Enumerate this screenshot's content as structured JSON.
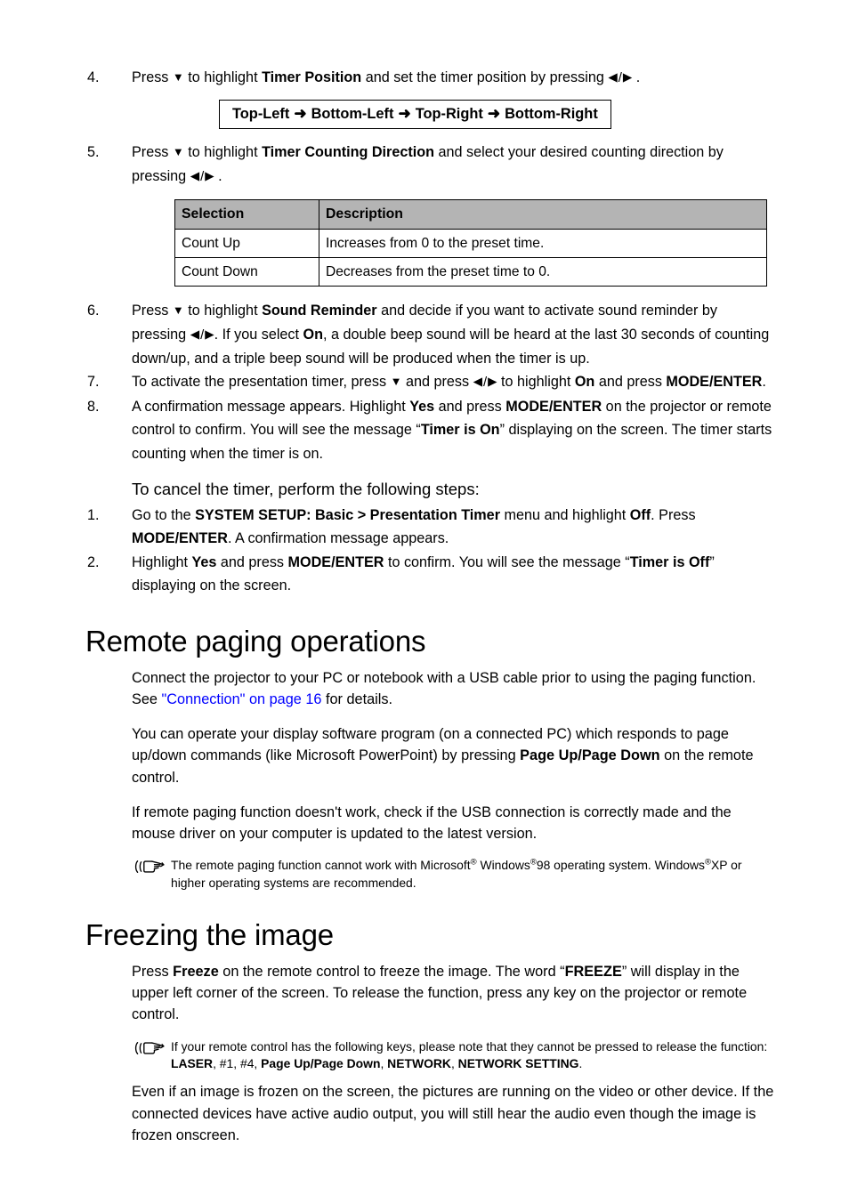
{
  "steps_timer": [
    {
      "num": "4.",
      "segments": [
        {
          "t": "Press ",
          "s": "n"
        },
        {
          "t": "▼",
          "s": "tri"
        },
        {
          "t": " to highlight ",
          "s": "n"
        },
        {
          "t": "Timer Position",
          "s": "b"
        },
        {
          "t": " and set the timer position by pressing ",
          "s": "n"
        },
        {
          "t": "◀/▶",
          "s": "lr"
        },
        {
          "t": " .",
          "s": "n"
        }
      ]
    },
    {
      "num": "5.",
      "segments": [
        {
          "t": "Press ",
          "s": "n"
        },
        {
          "t": "▼",
          "s": "tri"
        },
        {
          "t": " to highlight ",
          "s": "n"
        },
        {
          "t": "Timer Counting Direction",
          "s": "b"
        },
        {
          "t": " and select your desired counting direction by pressing ",
          "s": "n"
        },
        {
          "t": "◀/▶",
          "s": "lr"
        },
        {
          "t": " .",
          "s": "n"
        }
      ]
    },
    {
      "num": "6.",
      "segments": [
        {
          "t": "Press ",
          "s": "n"
        },
        {
          "t": "▼",
          "s": "tri"
        },
        {
          "t": " to highlight ",
          "s": "n"
        },
        {
          "t": "Sound Reminder",
          "s": "b"
        },
        {
          "t": " and decide if you want to activate sound reminder by pressing ",
          "s": "n"
        },
        {
          "t": "◀/▶",
          "s": "lr"
        },
        {
          "t": ". If you select ",
          "s": "n"
        },
        {
          "t": "On",
          "s": "b"
        },
        {
          "t": ", a double beep sound will be heard at the last 30 seconds of counting down/up, and a triple beep sound will be produced when the timer is up.",
          "s": "n"
        }
      ]
    },
    {
      "num": "7.",
      "segments": [
        {
          "t": "To activate the presentation timer, press ",
          "s": "n"
        },
        {
          "t": "▼",
          "s": "tri"
        },
        {
          "t": " and press ",
          "s": "n"
        },
        {
          "t": "◀/▶",
          "s": "lr"
        },
        {
          "t": " to highlight ",
          "s": "n"
        },
        {
          "t": "On",
          "s": "b"
        },
        {
          "t": " and press ",
          "s": "n"
        },
        {
          "t": "MODE/ENTER",
          "s": "b"
        },
        {
          "t": ".",
          "s": "n"
        }
      ]
    },
    {
      "num": "8.",
      "segments": [
        {
          "t": "A confirmation message appears. Highlight ",
          "s": "n"
        },
        {
          "t": "Yes",
          "s": "b"
        },
        {
          "t": " and press ",
          "s": "n"
        },
        {
          "t": "MODE/ENTER",
          "s": "b"
        },
        {
          "t": " on the projector or remote control to confirm. You will see the message “",
          "s": "n"
        },
        {
          "t": "Timer is On",
          "s": "b"
        },
        {
          "t": "” displaying on the screen. The timer starts counting when the timer is on.",
          "s": "n"
        }
      ]
    }
  ],
  "position_box": {
    "items": [
      "Top-Left",
      "Bottom-Left",
      "Top-Right",
      "Bottom-Right"
    ],
    "arrow": "➜"
  },
  "selection_table": {
    "headers": [
      "Selection",
      "Description"
    ],
    "rows": [
      [
        "Count Up",
        "Increases from 0 to the preset time."
      ],
      [
        "Count Down",
        "Decreases from the preset time to 0."
      ]
    ]
  },
  "cancel_section": {
    "heading": "To cancel the timer, perform the following steps:",
    "steps": [
      {
        "num": "1.",
        "segments": [
          {
            "t": "Go to the ",
            "s": "n"
          },
          {
            "t": "SYSTEM SETUP: Basic > Presentation Timer",
            "s": "b"
          },
          {
            "t": " menu and highlight ",
            "s": "n"
          },
          {
            "t": "Off",
            "s": "b"
          },
          {
            "t": ". Press ",
            "s": "n"
          },
          {
            "t": "MODE/ENTER",
            "s": "b"
          },
          {
            "t": ". A confirmation message appears.",
            "s": "n"
          }
        ]
      },
      {
        "num": "2.",
        "segments": [
          {
            "t": "Highlight ",
            "s": "n"
          },
          {
            "t": "Yes",
            "s": "b"
          },
          {
            "t": " and press ",
            "s": "n"
          },
          {
            "t": "MODE/ENTER",
            "s": "b"
          },
          {
            "t": " to confirm. You will see the message “",
            "s": "n"
          },
          {
            "t": "Timer is Off",
            "s": "b"
          },
          {
            "t": "” displaying on the screen.",
            "s": "n"
          }
        ]
      }
    ]
  },
  "remote_paging": {
    "heading": "Remote paging operations",
    "paragraphs": [
      [
        {
          "t": "Connect the projector to your PC or notebook with a USB cable prior to using the paging function. See ",
          "s": "n"
        },
        {
          "t": "\"Connection\" on page 16",
          "s": "link"
        },
        {
          "t": " for details.",
          "s": "n"
        }
      ],
      [
        {
          "t": "You can operate your display software program (on a connected PC) which responds to page up/down commands (like Microsoft PowerPoint) by pressing ",
          "s": "n"
        },
        {
          "t": "Page Up/Page Down",
          "s": "b"
        },
        {
          "t": " on the remote control.",
          "s": "n"
        }
      ],
      [
        {
          "t": "If remote paging function doesn't work, check if the USB connection is correctly made and the mouse driver on your computer is updated to the latest version.",
          "s": "n"
        }
      ]
    ],
    "note": [
      {
        "t": "The remote paging function cannot work with Microsoft",
        "s": "n"
      },
      {
        "t": "®",
        "s": "reg"
      },
      {
        "t": " Windows",
        "s": "n"
      },
      {
        "t": "®",
        "s": "reg"
      },
      {
        "t": "98 operating system. Windows",
        "s": "n"
      },
      {
        "t": "®",
        "s": "reg"
      },
      {
        "t": "XP or higher operating systems are recommended.",
        "s": "n"
      }
    ]
  },
  "freezing": {
    "heading": "Freezing the image",
    "paragraphs": [
      [
        {
          "t": "Press ",
          "s": "n"
        },
        {
          "t": "Freeze",
          "s": "b"
        },
        {
          "t": " on the remote control to freeze the image. The word “",
          "s": "n"
        },
        {
          "t": "FREEZE",
          "s": "b"
        },
        {
          "t": "” will display in the upper left corner of the screen. To release the function, press any key on the projector or remote control.",
          "s": "n"
        }
      ]
    ],
    "note": [
      {
        "t": "If your remote control has the following keys, please note that they cannot be pressed to release the function: ",
        "s": "n"
      },
      {
        "t": "LASER",
        "s": "b"
      },
      {
        "t": ", #1, #4, ",
        "s": "n"
      },
      {
        "t": "Page Up/Page Down",
        "s": "b"
      },
      {
        "t": ", ",
        "s": "n"
      },
      {
        "t": "NETWORK",
        "s": "b"
      },
      {
        "t": ", ",
        "s": "n"
      },
      {
        "t": "NETWORK SETTING",
        "s": "b"
      },
      {
        "t": ".",
        "s": "n"
      }
    ],
    "closing_paragraph": [
      {
        "t": "Even if an image is frozen on the screen, the pictures are running on the video or other device. If the connected devices have active audio output, you will still hear the audio even though the image is frozen onscreen.",
        "s": "n"
      }
    ]
  },
  "colors": {
    "link": "#0000ff",
    "table_header_bg": "#b4b4b4",
    "text": "#000000"
  },
  "icons": {
    "note": "pointing-hand-icon",
    "down_triangle": "▼",
    "left_triangle": "◀",
    "right_triangle": "▶"
  }
}
